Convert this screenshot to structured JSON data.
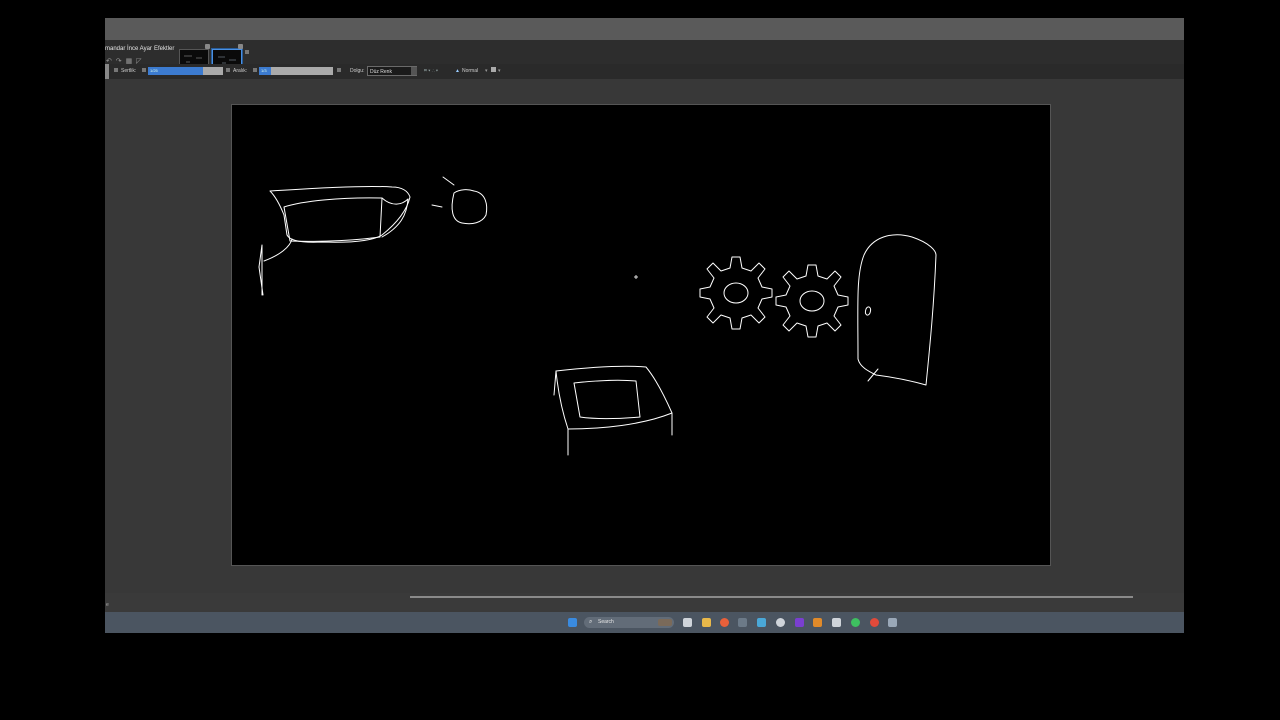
{
  "ribbon": {
    "tabs": [
      "mandar",
      "İnce Ayar",
      "Efektler"
    ]
  },
  "toolbar": {
    "thickness_label": "Sertlik:",
    "thickness_value": "1/25",
    "opacity_label": "Aralık:",
    "opacity_value": "1/3",
    "fill_label": "Dolgu:",
    "fill_value": "Düz Renk",
    "blend_value": "Normal"
  },
  "taskbar": {
    "search_placeholder": "Search"
  },
  "status": {
    "text": "e"
  },
  "colors": {
    "canvas": "#000000",
    "stroke": "#ffffff",
    "accent": "#3c7bd0",
    "workspace": "#383838"
  }
}
